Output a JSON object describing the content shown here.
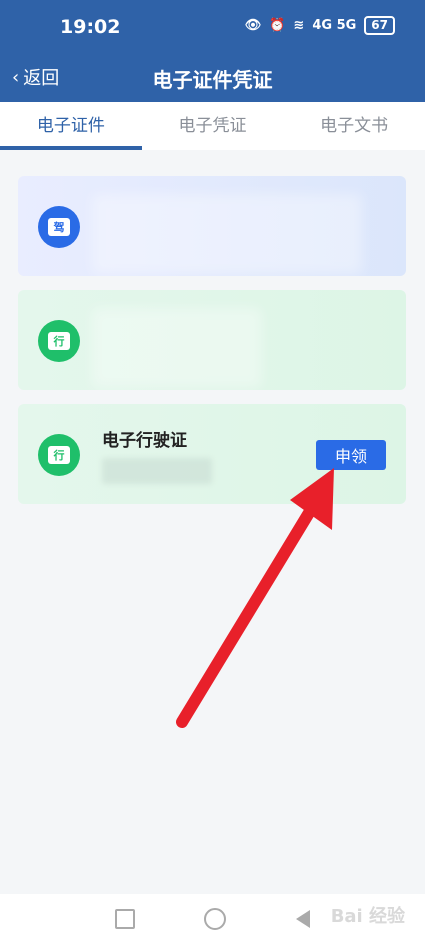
{
  "status": {
    "time": "19:02",
    "network": "4G 5G",
    "battery": "67"
  },
  "header": {
    "back_label": "返回",
    "title": "电子证件凭证"
  },
  "tabs": [
    {
      "label": "电子证件",
      "active": true
    },
    {
      "label": "电子凭证",
      "active": false
    },
    {
      "label": "电子文书",
      "active": false
    }
  ],
  "cards": [
    {
      "icon_text": "驾",
      "icon": "driver-license-icon",
      "title": "",
      "button": ""
    },
    {
      "icon_text": "行",
      "icon": "vehicle-license-icon",
      "title": "",
      "button": ""
    },
    {
      "icon_text": "行",
      "icon": "vehicle-license-icon",
      "title": "电子行驶证",
      "button": "申领"
    }
  ],
  "watermark": "Bai 经验",
  "colors": {
    "primary": "#2f62a8",
    "button": "#2a6be6",
    "green": "#1fbf6a",
    "arrow": "#e8202a"
  }
}
